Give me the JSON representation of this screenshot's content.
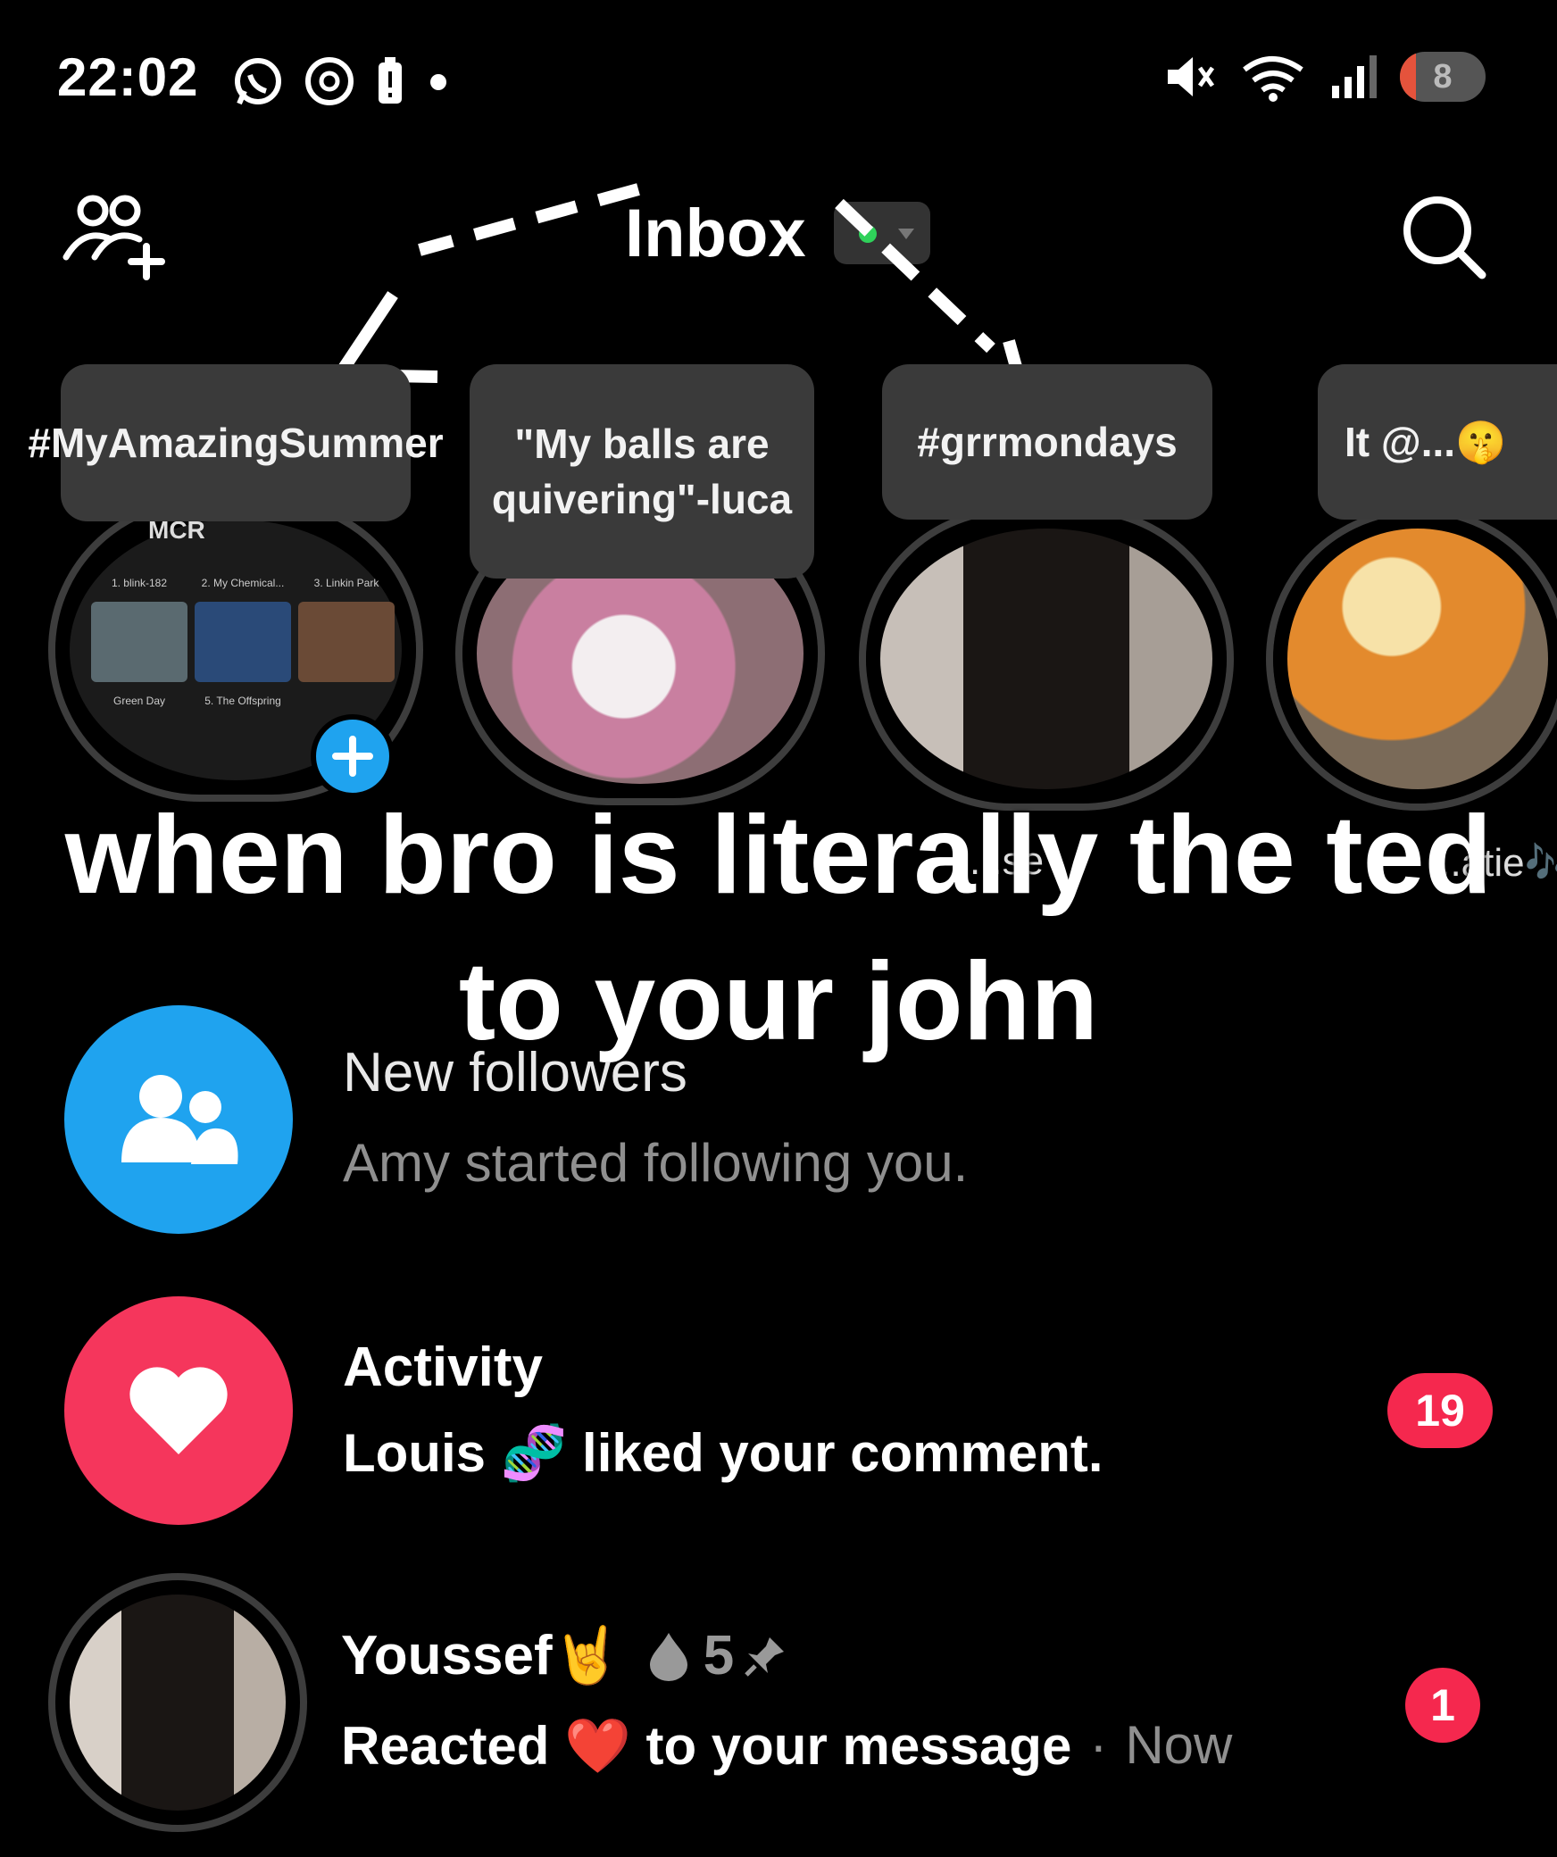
{
  "status_bar": {
    "time": "22:02",
    "battery": "8",
    "icons": [
      "whatsapp-icon",
      "threads-icon",
      "battery-alert-icon",
      "dot-icon",
      "mute-icon",
      "wifi-icon",
      "signal-icon"
    ]
  },
  "header": {
    "title": "Inbox",
    "left_icon": "add-friends-icon",
    "right_icon": "search-icon"
  },
  "stories": [
    {
      "note": "#MyAmazingSummer",
      "thumbnail": {
        "banner": "MCR",
        "tiles": [
          "1. blink-182",
          "2. My Chemical...",
          "3. Linkin Park",
          "Green Day",
          "5. The Offspring"
        ]
      }
    },
    {
      "note": "\"My balls are quivering\"-luca"
    },
    {
      "note": "#grrmondays"
    },
    {
      "note": "It @...🤫"
    }
  ],
  "story_labels_partial": [
    "...se",
    "...atie🎶"
  ],
  "caption": {
    "line1": "when bro is literally the ted",
    "line2": "to your john"
  },
  "list": [
    {
      "title": "New followers",
      "subtitle": "Amy started following you.",
      "icon": "people-icon",
      "color": "#1fa3ef"
    },
    {
      "title": "Activity",
      "subtitle": "Louis 🧬 liked your comment.",
      "icon": "heart-icon",
      "color": "#f5365c",
      "badge": "19"
    },
    {
      "title": "Youssef🤘",
      "streak": "5",
      "subtitle": "Reacted ❤️ to your message",
      "time": "Now",
      "badge": "1"
    }
  ],
  "colors": {
    "background": "#000000",
    "badge": "#f5284e",
    "accent_blue": "#1fa3ef",
    "accent_pink": "#f5365c"
  }
}
